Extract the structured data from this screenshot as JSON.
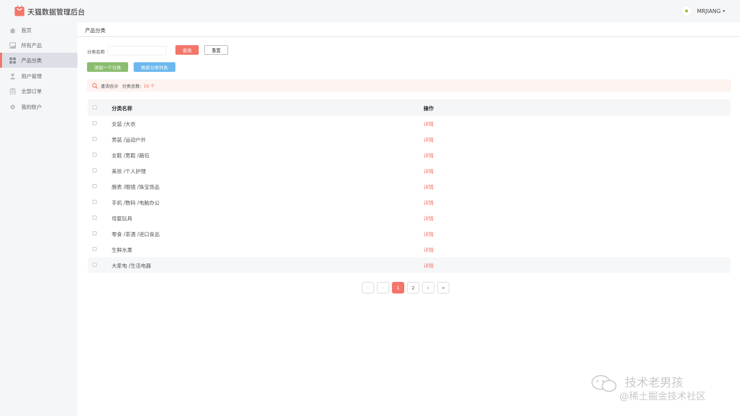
{
  "header": {
    "brand": "天猫数据管理后台",
    "user_name": "MRJIANG",
    "caret": "▾"
  },
  "sidebar": {
    "items": [
      {
        "label": "首页",
        "icon": "home-icon"
      },
      {
        "label": "所有产品",
        "icon": "image-icon"
      },
      {
        "label": "产品分类",
        "icon": "grid-icon",
        "active": true
      },
      {
        "label": "用户管理",
        "icon": "user-icon"
      },
      {
        "label": "全部订单",
        "icon": "clipboard-icon"
      },
      {
        "label": "我的账户",
        "icon": "gear-icon"
      }
    ]
  },
  "breadcrumb": "产品分类",
  "search": {
    "label": "分类名称",
    "placeholder": "",
    "query_button": "查询",
    "reset_button": "重置"
  },
  "actions": {
    "add_button": "添加一个分类",
    "refresh_button": "刷新分类列表"
  },
  "summary": {
    "title": "查询合计",
    "count_label": "分类总数:",
    "count_value": "16 个"
  },
  "table": {
    "headers": [
      "分类名称",
      "操作"
    ],
    "rows": [
      {
        "name": "女装 /大衣",
        "action": "详情"
      },
      {
        "name": "男装 /运动户外",
        "action": "详情"
      },
      {
        "name": "女鞋 /男鞋 /箱包",
        "action": "详情"
      },
      {
        "name": "美妆 /个人护理",
        "action": "详情"
      },
      {
        "name": "腕表 /眼镜 /珠宝饰品",
        "action": "详情"
      },
      {
        "name": "手机 /数码 /电脑办公",
        "action": "详情"
      },
      {
        "name": "母婴玩具",
        "action": "详情"
      },
      {
        "name": "零食 /茶酒 /进口食品",
        "action": "详情"
      },
      {
        "name": "生鲜水果",
        "action": "详情"
      },
      {
        "name": "大家电 /生活电器",
        "action": "详情"
      }
    ]
  },
  "pagination": {
    "first": "‹",
    "prev": "‹",
    "pages": [
      "1",
      "2"
    ],
    "current": "1",
    "next": "›",
    "last": "»"
  },
  "watermark": {
    "line1": "技术老男孩",
    "line2": "@稀土掘金技术社区"
  },
  "colors": {
    "accent": "#f4766a",
    "add_button": "#8bbd6e",
    "refresh_button": "#6cb8ee",
    "sidebar_bg": "#f5f6f8"
  }
}
